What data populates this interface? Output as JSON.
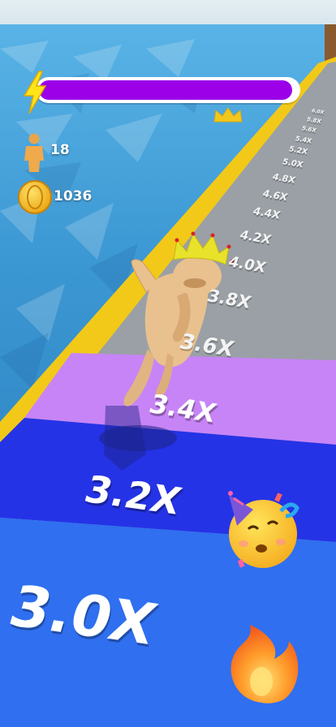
{
  "hud": {
    "progress_fraction": 0.98,
    "progress_color": "#9b00e8",
    "followers": "18",
    "coins": "1036"
  },
  "track": {
    "multipliers": [
      "3.0X",
      "3.2X",
      "3.4X",
      "3.6X",
      "3.8X",
      "4.0X",
      "4.2X",
      "4.4X",
      "4.6X",
      "4.8X",
      "5.0X",
      "5.2X",
      "5.4X",
      "5.6X",
      "5.8X",
      "6.0X"
    ],
    "lane_colors": {
      "near": "#2f6ff0",
      "mid": "#2533e6",
      "violet": "#c784f6",
      "grey": "#9aa0a6",
      "edge": "#f2c918"
    }
  },
  "colors": {
    "water": "#3a9ad0",
    "character": "#e9c18f",
    "crown": "#e8e22a"
  },
  "icons": [
    "lightning-icon",
    "crown-icon",
    "person-icon",
    "coin-icon",
    "party-emoji",
    "fire-emoji"
  ]
}
